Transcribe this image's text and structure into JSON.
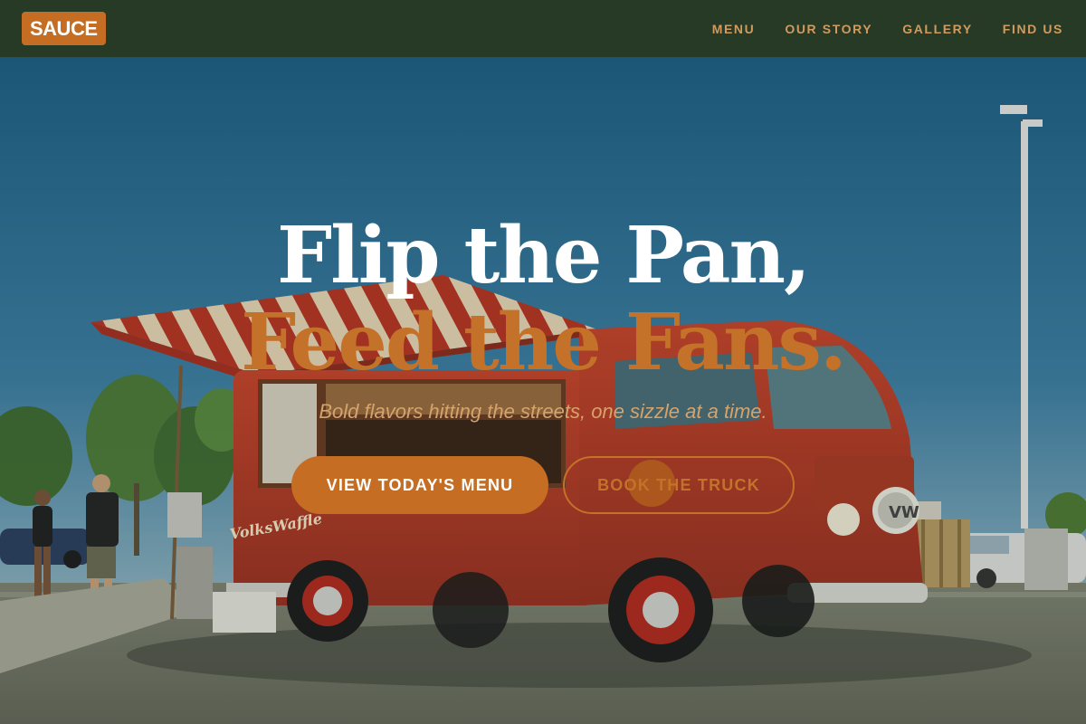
{
  "brand": {
    "logo_text": "SAUCE"
  },
  "nav": {
    "links": [
      {
        "label": "MENU"
      },
      {
        "label": "OUR STORY"
      },
      {
        "label": "GALLERY"
      },
      {
        "label": "FIND US"
      }
    ]
  },
  "hero": {
    "headline_line1": "Flip the Pan,",
    "headline_line2": "Feed the Fans.",
    "tagline": "Bold flavors hitting the streets, one sizzle at a time.",
    "primary_cta": "VIEW TODAY'S MENU",
    "secondary_cta": "BOOK THE TRUCK",
    "truck_signage": "VolksWaffle"
  },
  "colors": {
    "nav_bg": "#263a25",
    "accent": "#c46d23",
    "nav_link": "#d19a5e",
    "headline_white": "#ffffff",
    "headline_orange": "#c4712a"
  }
}
